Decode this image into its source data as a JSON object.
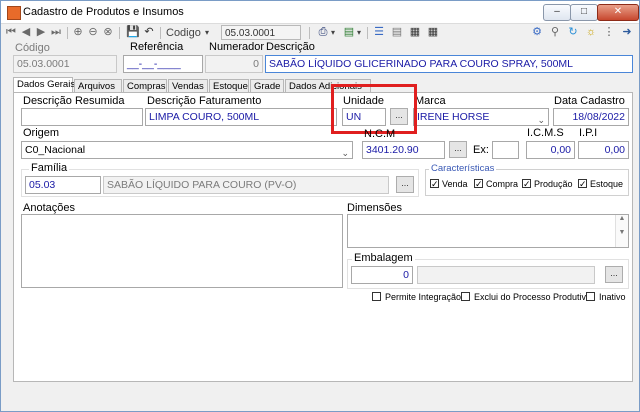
{
  "window": {
    "title": "Cadastro de Produtos e Insumos"
  },
  "toolbar": {
    "codigo_label": "Codigo",
    "codigo_value": "05.03.0001"
  },
  "header": {
    "codigo_label": "Código",
    "codigo_value": "05.03.0001",
    "referencia_label": "Referência",
    "referencia_value": "__-__-____",
    "numerador_label": "Numerador",
    "numerador_value": "0",
    "descricao_label": "Descrição",
    "descricao_value": "SABÃO LÍQUIDO GLICERINADO PARA COURO SPRAY, 500ML"
  },
  "tabs": [
    "Dados Gerais",
    "Arquivos",
    "Compras",
    "Vendas",
    "Estoque",
    "Grade",
    "Dados Adicionais"
  ],
  "form": {
    "descricao_resumida_label": "Descrição Resumida",
    "descricao_resumida_value": "",
    "descricao_faturamento_label": "Descrição Faturamento",
    "descricao_faturamento_value": "LIMPA COURO, 500ML",
    "unidade_label": "Unidade",
    "unidade_value": "UN",
    "marca_label": "Marca",
    "marca_value": "IRENE HORSE",
    "data_cadastro_label": "Data Cadastro",
    "data_cadastro_value": "18/08/2022",
    "origem_label": "Origem",
    "origem_value": "C0_Nacional",
    "ncm_label": "N.C.M",
    "ncm_value": "3401.20.90",
    "ex_label": "Ex:",
    "ex_value": "",
    "icms_label": "I.C.M.S",
    "icms_value": "0,00",
    "ipi_label": "I.P.I",
    "ipi_value": "0,00",
    "familia_label": "Família",
    "familia_code": "05.03",
    "familia_desc": "SABÃO LÍQUIDO PARA COURO (PV-O)",
    "caracteristicas_label": "Características",
    "caracteristicas": [
      {
        "label": "Venda",
        "checked": true
      },
      {
        "label": "Compra",
        "checked": true
      },
      {
        "label": "Produção",
        "checked": true
      },
      {
        "label": "Estoque",
        "checked": true
      }
    ],
    "anotacoes_label": "Anotações",
    "dimensoes_label": "Dimensões",
    "embalagem_label": "Embalagem",
    "embalagem_value": "0",
    "embalagem_desc": "",
    "options": [
      {
        "label": "Permite Integração",
        "checked": false
      },
      {
        "label": "Exclui do Processo Produtivo",
        "checked": false
      },
      {
        "label": "Inativo",
        "checked": false
      }
    ],
    "dots_label": "..."
  }
}
